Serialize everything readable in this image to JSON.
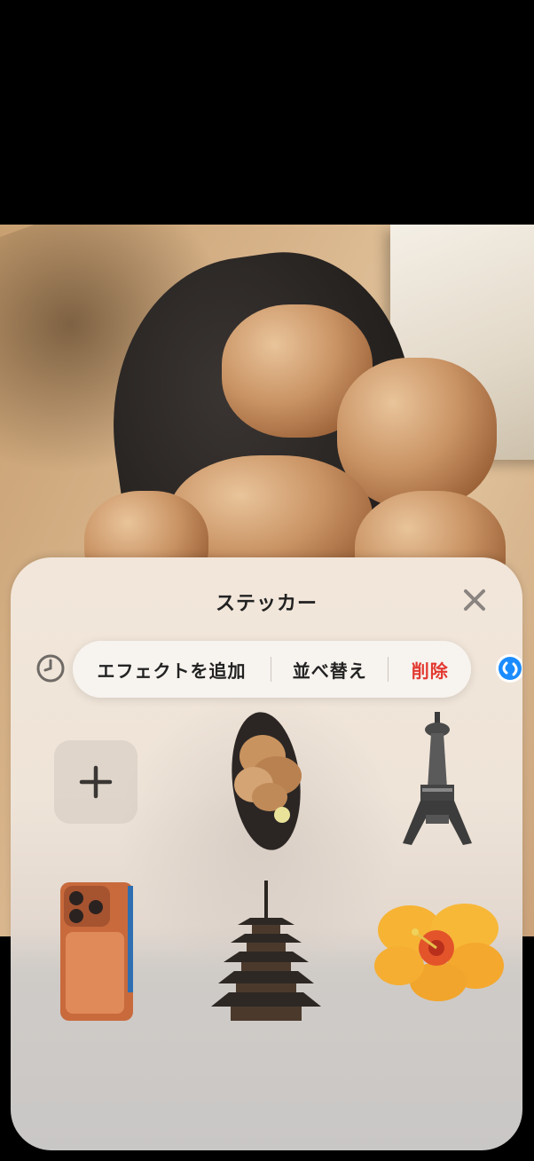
{
  "sheet": {
    "title": "ステッカー",
    "close_icon": "close-x-icon"
  },
  "toolbar": {
    "recent_icon": "clock-icon",
    "add_effect_label": "エフェクトを追加",
    "reorder_label": "並べ替え",
    "delete_label": "削除",
    "delete_color": "#e2382f",
    "shazam_icon": "shazam-icon"
  },
  "stickers": [
    {
      "type": "add",
      "icon": "plus-icon"
    },
    {
      "type": "sticker",
      "subject": "fried chicken on plate"
    },
    {
      "type": "sticker",
      "subject": "lattice tower"
    },
    {
      "type": "sticker",
      "subject": "orange smartphone"
    },
    {
      "type": "sticker",
      "subject": "five-story pagoda"
    },
    {
      "type": "sticker",
      "subject": "yellow hibiscus flower"
    }
  ]
}
